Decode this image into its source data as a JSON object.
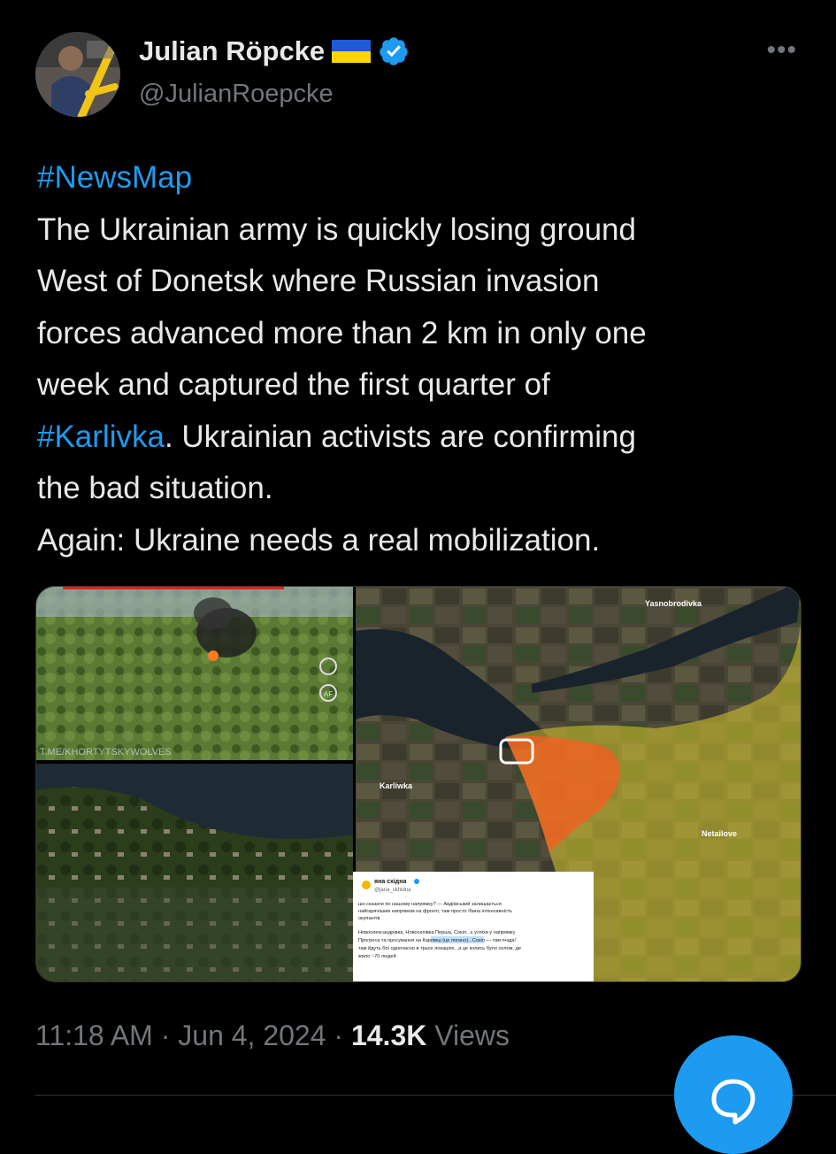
{
  "author": {
    "display_name": "Julian Röpcke",
    "handle": "@JulianRoepcke",
    "verified": true
  },
  "icons": {
    "flag": "ukraine-flag-icon",
    "verified": "verified-badge-icon",
    "more": "more-options-icon",
    "compose": "compose-reply-icon"
  },
  "tweet": {
    "line1_tag": "#NewsMap",
    "line2": "The Ukrainian army is quickly losing ground",
    "line3": "West of Donetsk where Russian invasion",
    "line4": "forces advanced more than 2 km in only one",
    "line5": "week and captured the first quarter of",
    "line6_tag": "#Karlivka",
    "line6_rest": ". Ukrainian activists are confirming",
    "line7": "the bad situation.",
    "line8": "Again: Ukraine needs a real mobilization."
  },
  "media": {
    "watermark": "T.ME/KHORTYTSKYWOLVES",
    "map_labels": {
      "yasnobrodivka": "Yasnobrodivka",
      "karliwka": "Karliwka",
      "netailove": "Netailove"
    },
    "drone_hud": {
      "af": "AF"
    },
    "embedded_post": {
      "name": "яна східна",
      "handle": "@jana_skhidna",
      "para1_l1": "шо сказати по нашому напрямку? — Авдіївський залишається",
      "para1_l2": "найгарячішим напрямом на фронті, там просто їбана інтенсивність",
      "para1_l3": "окупантів",
      "para2_l1": "Новоолександрівка, Новоселівка Перша, Сокіл...є успіхи у напрямку",
      "para2_l2_a": "Прогреса та просування на ",
      "para2_l2_hl": "Карлівці (це погано)",
      "para2_l2_b": "...Сокіл — там п•зда!",
      "para2_l3": "там йдуть бої одночасно в трьох локаціях...а це колись було селом, де",
      "para2_l4": "жило ~70 людей"
    }
  },
  "meta": {
    "time": "11:18 AM",
    "sep1": " · ",
    "date": "Jun 4, 2024",
    "sep2": " · ",
    "views_count": "14.3K",
    "views_label": " Views"
  },
  "colors": {
    "background": "#000000",
    "text": "#e7e9ea",
    "secondary": "#71767b",
    "accent": "#1d9bf0"
  }
}
